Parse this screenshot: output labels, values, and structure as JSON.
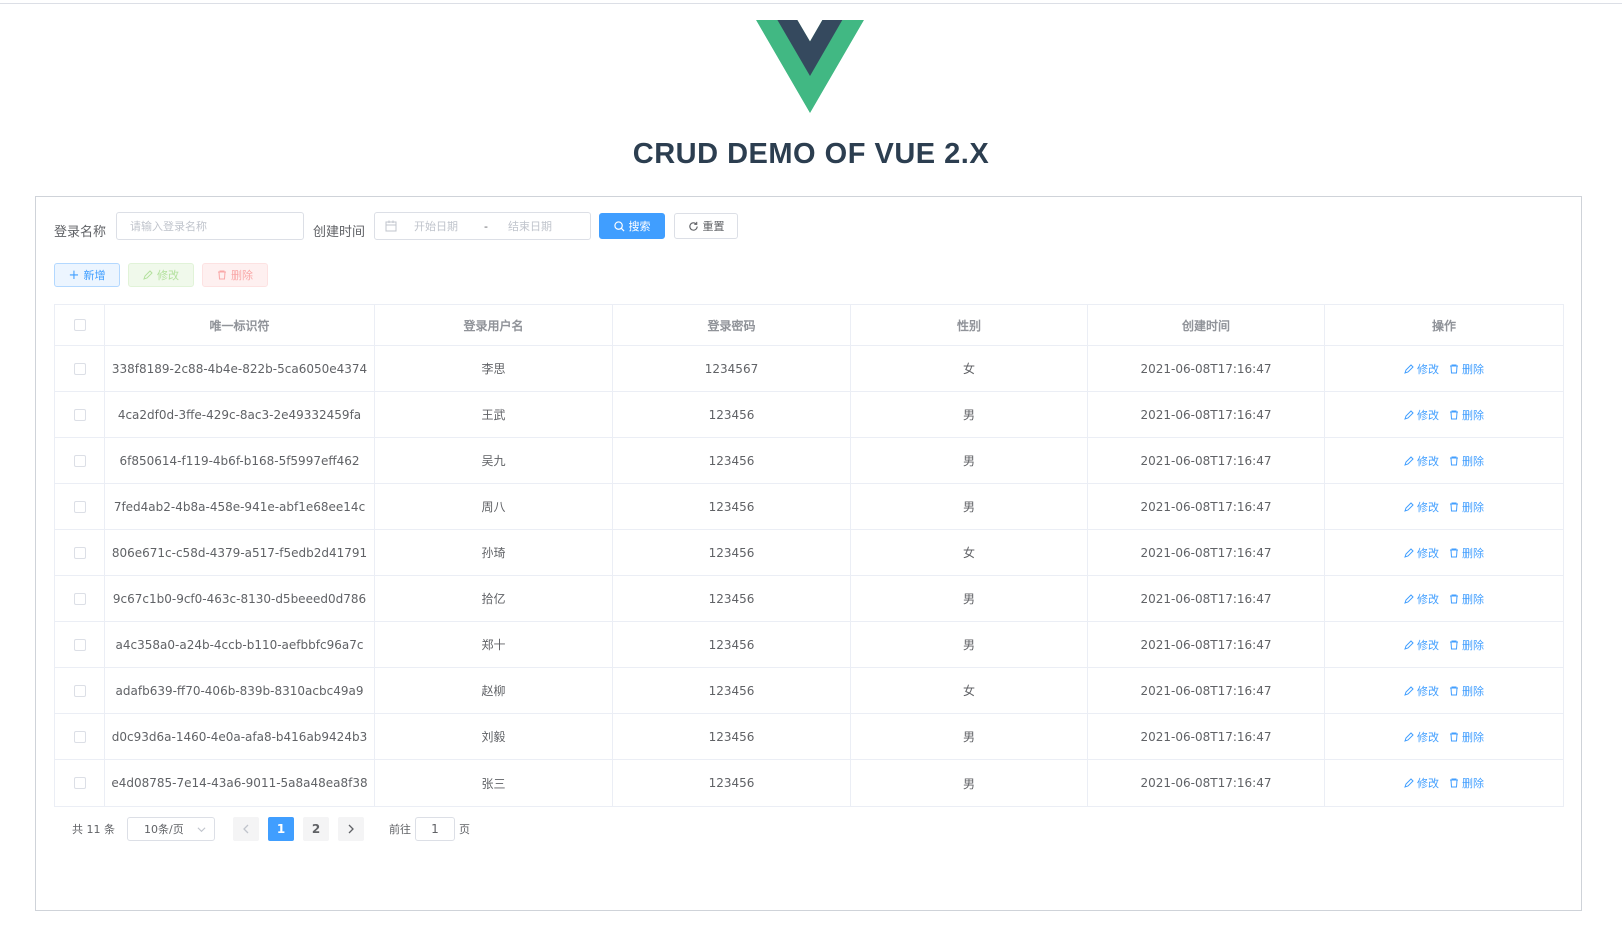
{
  "app": {
    "title": "CRUD DEMO OF VUE 2.X",
    "logo": "vue-logo"
  },
  "search": {
    "name_label": "登录名称",
    "name_placeholder": "请输入登录名称",
    "name_value": "",
    "time_label": "创建时间",
    "start_placeholder": "开始日期",
    "range_separator": "-",
    "end_placeholder": "结束日期",
    "search_label": "搜索",
    "reset_label": "重置"
  },
  "toolbar": {
    "add_label": "新增",
    "edit_label": "修改",
    "delete_label": "删除"
  },
  "table": {
    "headers": [
      "唯一标识符",
      "登录用户名",
      "登录密码",
      "性别",
      "创建时间",
      "操作"
    ],
    "edit_label": "修改",
    "delete_label": "删除",
    "rows": [
      {
        "id": "338f8189-2c88-4b4e-822b-5ca6050e4374",
        "username": "李思",
        "password": "1234567",
        "gender": "女",
        "created": "2021-06-08T17:16:47"
      },
      {
        "id": "4ca2df0d-3ffe-429c-8ac3-2e49332459fa",
        "username": "王武",
        "password": "123456",
        "gender": "男",
        "created": "2021-06-08T17:16:47"
      },
      {
        "id": "6f850614-f119-4b6f-b168-5f5997eff462",
        "username": "吴九",
        "password": "123456",
        "gender": "男",
        "created": "2021-06-08T17:16:47"
      },
      {
        "id": "7fed4ab2-4b8a-458e-941e-abf1e68ee14c",
        "username": "周八",
        "password": "123456",
        "gender": "男",
        "created": "2021-06-08T17:16:47"
      },
      {
        "id": "806e671c-c58d-4379-a517-f5edb2d41791",
        "username": "孙琦",
        "password": "123456",
        "gender": "女",
        "created": "2021-06-08T17:16:47"
      },
      {
        "id": "9c67c1b0-9cf0-463c-8130-d5beeed0d786",
        "username": "拾亿",
        "password": "123456",
        "gender": "男",
        "created": "2021-06-08T17:16:47"
      },
      {
        "id": "a4c358a0-a24b-4ccb-b110-aefbbfc96a7c",
        "username": "郑十",
        "password": "123456",
        "gender": "男",
        "created": "2021-06-08T17:16:47"
      },
      {
        "id": "adafb639-ff70-406b-839b-8310acbc49a9",
        "username": "赵柳",
        "password": "123456",
        "gender": "女",
        "created": "2021-06-08T17:16:47"
      },
      {
        "id": "d0c93d6a-1460-4e0a-afa8-b416ab9424b3",
        "username": "刘毅",
        "password": "123456",
        "gender": "男",
        "created": "2021-06-08T17:16:47"
      },
      {
        "id": "e4d08785-7e14-43a6-9011-5a8a48ea8f38",
        "username": "张三",
        "password": "123456",
        "gender": "男",
        "created": "2021-06-08T17:16:47"
      }
    ]
  },
  "pagination": {
    "total_text": "共 11 条",
    "page_size": "10条/页",
    "pages": [
      "1",
      "2"
    ],
    "current_page": "1",
    "goto_label": "前往",
    "goto_value": "1",
    "goto_suffix": "页"
  },
  "colors": {
    "primary": "#409eff",
    "vue_green": "#41b883",
    "vue_dark": "#35495e",
    "title": "#2c3e50"
  }
}
